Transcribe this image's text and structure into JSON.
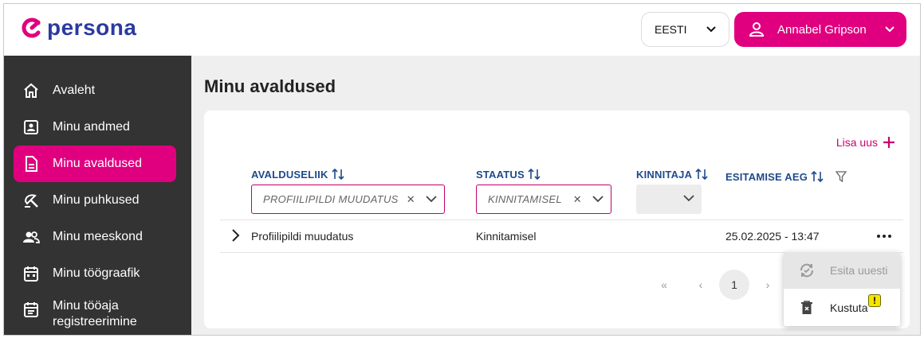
{
  "app": {
    "logo_text": "persona",
    "brand_color": "#e0007f",
    "logo_color": "#2b3aa0"
  },
  "header": {
    "language": {
      "selected": "EESTI",
      "icon": "chevron-down-icon"
    },
    "user": {
      "name": "Annabel Gripson",
      "icon": "user-icon"
    }
  },
  "sidebar": {
    "items": [
      {
        "label": "Avaleht",
        "icon": "home-icon",
        "active": false
      },
      {
        "label": "Minu andmed",
        "icon": "id-card-icon",
        "active": false
      },
      {
        "label": "Minu avaldused",
        "icon": "document-icon",
        "active": true
      },
      {
        "label": "Minu puhkused",
        "icon": "beach-umbrella-icon",
        "active": false
      },
      {
        "label": "Minu meeskond",
        "icon": "team-icon",
        "active": false
      },
      {
        "label": "Minu töögraafik",
        "icon": "calendar-icon",
        "active": false
      },
      {
        "label_line1": "Minu tööaja",
        "label_line2": "registreerimine",
        "icon": "timesheet-icon",
        "active": false
      }
    ]
  },
  "main": {
    "title": "Minu avaldused",
    "add_new": "Lisa uus",
    "columns": [
      {
        "label": "AVALDUSELIIK",
        "filter_value": "PROFIILIPILDI MUUDATUS"
      },
      {
        "label": "STAATUS",
        "filter_value": "KINNITAMISEL"
      },
      {
        "label": "KINNITAJA",
        "filter_value": ""
      },
      {
        "label": "ESITAMISE AEG",
        "filter_value": ""
      }
    ],
    "rows": [
      {
        "type": "Profiilipildi muudatus",
        "status": "Kinnitamisel",
        "approver": "",
        "submitted": "25.02.2025 - 13:47"
      }
    ],
    "pagination": {
      "current_page": "1"
    }
  },
  "context_menu": {
    "items": [
      {
        "label": "Esita uuesti",
        "icon": "resubmit-icon",
        "disabled": true
      },
      {
        "label": "Kustuta",
        "icon": "trash-icon",
        "disabled": false
      }
    ],
    "badge": "!"
  }
}
